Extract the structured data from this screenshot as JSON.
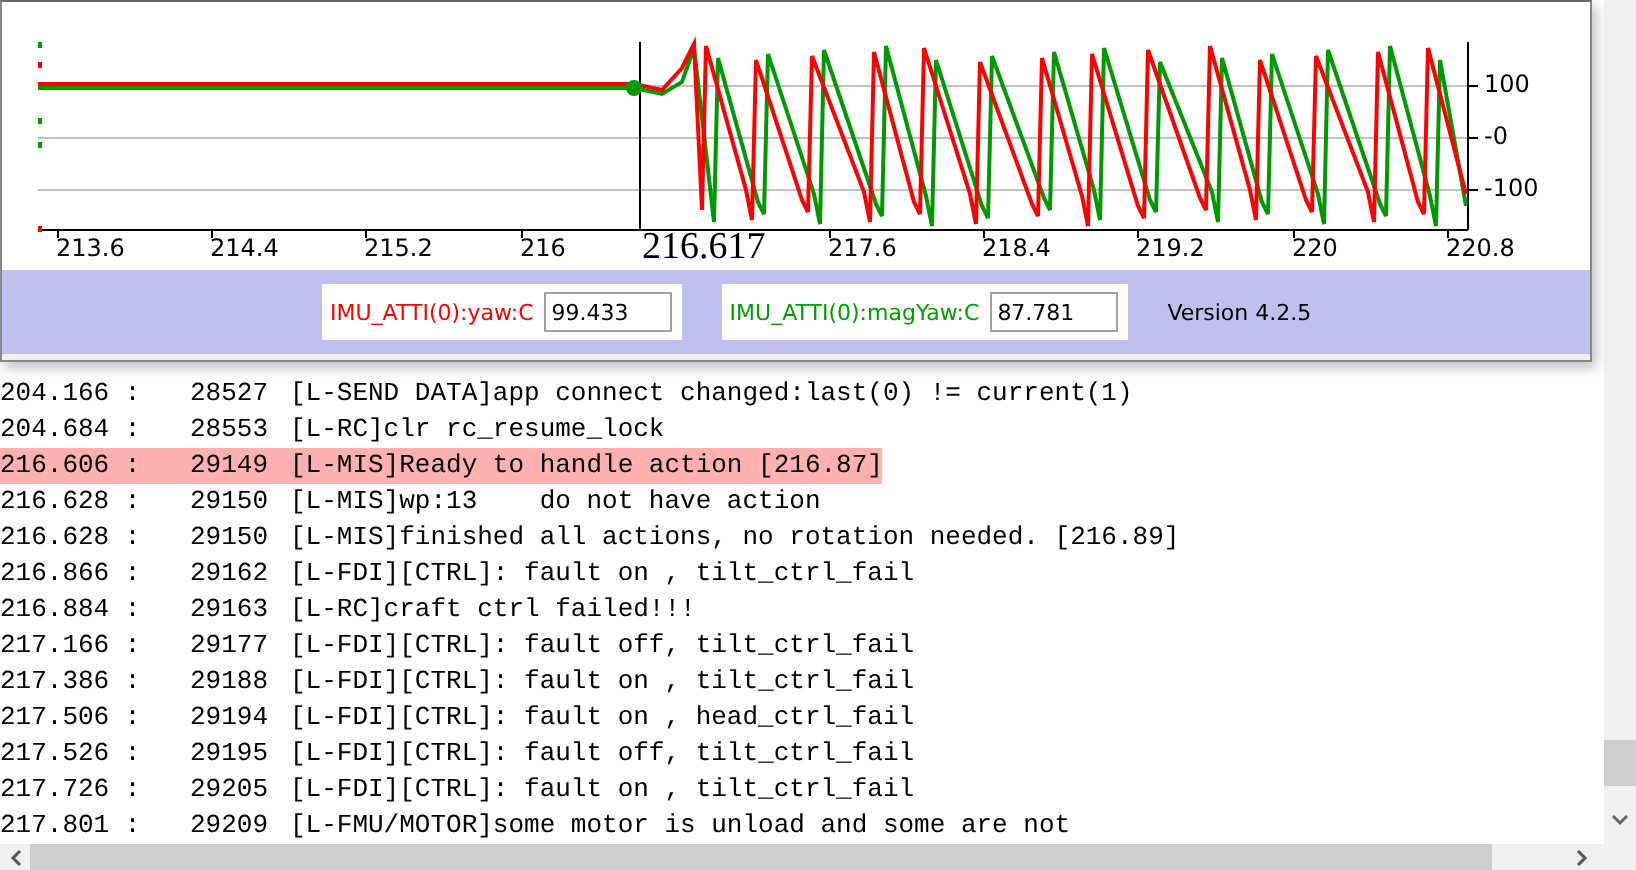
{
  "chart_window": {
    "x_ticks": [
      "213.6",
      "214.4",
      "215.2",
      "216",
      "217.6",
      "218.4",
      "219.2",
      "220",
      "220.8"
    ],
    "y_ticks": [
      "100",
      "-0",
      "-100"
    ],
    "cursor_label": "216.617",
    "fields": [
      {
        "label": "IMU_ATTI(0):yaw:C",
        "value": "99.433",
        "color": "#ff0000"
      },
      {
        "label": "IMU_ATTI(0):magYaw:C",
        "value": "87.781",
        "color": "#00a000"
      }
    ],
    "version": "Version 4.2.5"
  },
  "log": {
    "rows": [
      {
        "time": "204.166 :",
        "seq": "28527",
        "message": "[L-SEND DATA]app connect changed:last(0) != current(1)",
        "highlighted": false
      },
      {
        "time": "204.684 :",
        "seq": "28553",
        "message": "[L-RC]clr rc_resume_lock",
        "highlighted": false
      },
      {
        "time": "216.606 :",
        "seq": "29149",
        "message": "[L-MIS]Ready to handle action [216.87]",
        "highlighted": true
      },
      {
        "time": "216.628 :",
        "seq": "29150",
        "message": "[L-MIS]wp:13    do not have action",
        "highlighted": false
      },
      {
        "time": "216.628 :",
        "seq": "29150",
        "message": "[L-MIS]finished all actions, no rotation needed. [216.89]",
        "highlighted": false
      },
      {
        "time": "216.866 :",
        "seq": "29162",
        "message": "[L-FDI][CTRL]: fault on , tilt_ctrl_fail",
        "highlighted": false
      },
      {
        "time": "216.884 :",
        "seq": "29163",
        "message": "[L-RC]craft ctrl failed!!!",
        "highlighted": false
      },
      {
        "time": "217.166 :",
        "seq": "29177",
        "message": "[L-FDI][CTRL]: fault off, tilt_ctrl_fail",
        "highlighted": false
      },
      {
        "time": "217.386 :",
        "seq": "29188",
        "message": "[L-FDI][CTRL]: fault on , tilt_ctrl_fail",
        "highlighted": false
      },
      {
        "time": "217.506 :",
        "seq": "29194",
        "message": "[L-FDI][CTRL]: fault on , head_ctrl_fail",
        "highlighted": false
      },
      {
        "time": "217.526 :",
        "seq": "29195",
        "message": "[L-FDI][CTRL]: fault off, tilt_ctrl_fail",
        "highlighted": false
      },
      {
        "time": "217.726 :",
        "seq": "29205",
        "message": "[L-FDI][CTRL]: fault on , tilt_ctrl_fail",
        "highlighted": false
      },
      {
        "time": "217.801 :",
        "seq": "29209",
        "message": "[L-FMU/MOTOR]some motor is unload and some are not",
        "highlighted": false
      }
    ]
  }
}
